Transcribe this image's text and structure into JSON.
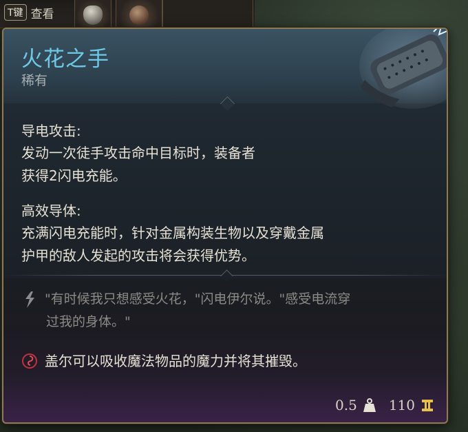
{
  "inventory_bar": {
    "key": "T键",
    "key_action": "查看"
  },
  "tooltip": {
    "name": "火花之手",
    "rarity": "稀有",
    "name_color": "#6ec9e6",
    "abilities": [
      {
        "title": "导电攻击:",
        "lines": [
          "发动一次徒手攻击命中目标时，装备者",
          "获得2闪电充能。"
        ]
      },
      {
        "title": "高效导体:",
        "lines": [
          "充满闪电充能时，针对金属构装生物以及穿戴金属",
          "护甲的敌人发起的攻击将会获得优势。"
        ]
      }
    ],
    "flavor_lines": [
      "\"有时候我只想感受火花，\"闪电伊尔说。\"感受电流穿",
      "过我的身体。\""
    ],
    "note": "盖尔可以吸收魔法物品的魔力并将其摧毁。",
    "weight": "0.5",
    "value": "110",
    "icons": {
      "flavor": "quote-bolt-icon",
      "note": "gale-spiral-icon",
      "weight": "weight-icon",
      "value": "gold-icon"
    }
  }
}
